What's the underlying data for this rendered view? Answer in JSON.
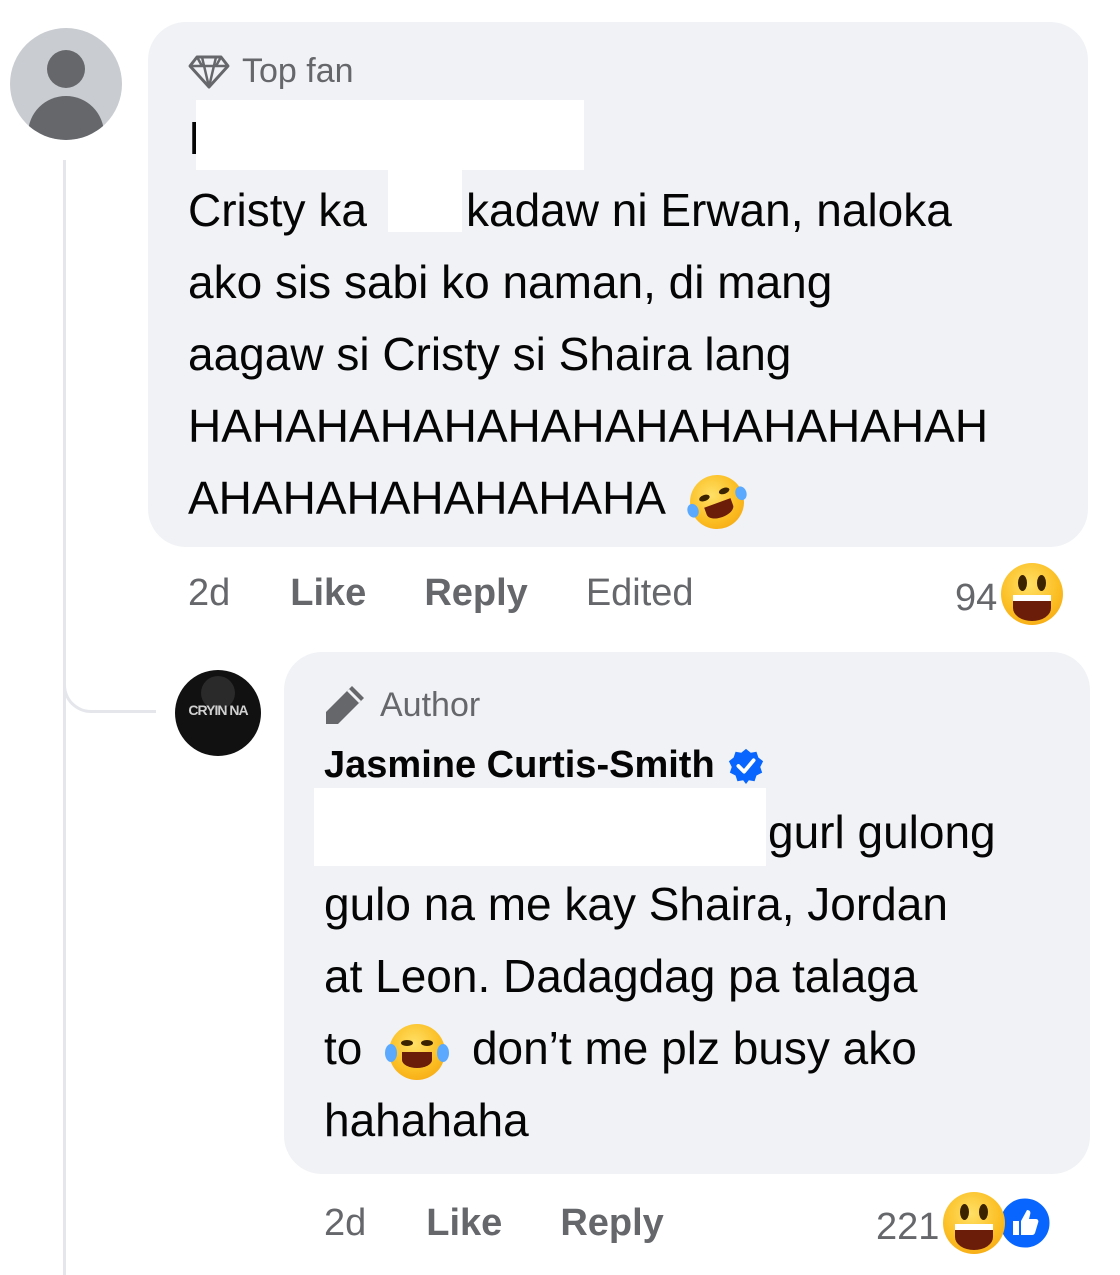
{
  "comment": {
    "badge": "Top fan",
    "badge_icon": "diamond-icon",
    "lines": [
      "I",
      "Cristy ka",
      "kadaw ni Erwan, naloka",
      "ako sis sabi ko naman, di mang",
      "aagaw si Cristy si Shaira lang",
      "HAHAHAHAHAHAHAHAHAHAHAHAH",
      "AHAHAHAHAHAHAHA"
    ],
    "emoji": "rolling-on-floor-laughing-emoji",
    "time": "2d",
    "like_label": "Like",
    "reply_label": "Reply",
    "edited_label": "Edited",
    "reaction_count": "94",
    "reaction_icon": "grinning-face-emoji"
  },
  "reply": {
    "badge": "Author",
    "badge_icon": "pencil-icon",
    "author": "Jasmine Curtis-Smith",
    "verified_icon": "verified-badge-icon",
    "avatar_text": "CRYIN NA",
    "lines": [
      "gurl gulong",
      "gulo na me kay Shaira, Jordan",
      "at Leon. Dadagdag pa talaga",
      "to",
      "don’t me plz busy ako",
      "hahahaha"
    ],
    "emoji": "face-with-tears-of-joy-emoji",
    "time": "2d",
    "like_label": "Like",
    "reply_label": "Reply",
    "reaction_count": "221",
    "reaction_icons": [
      "grinning-face-emoji",
      "like-thumbs-up-icon"
    ]
  },
  "colors": {
    "bubble": "#f0f2f5",
    "meta_text": "#65676b",
    "verified_blue": "#0866ff"
  }
}
